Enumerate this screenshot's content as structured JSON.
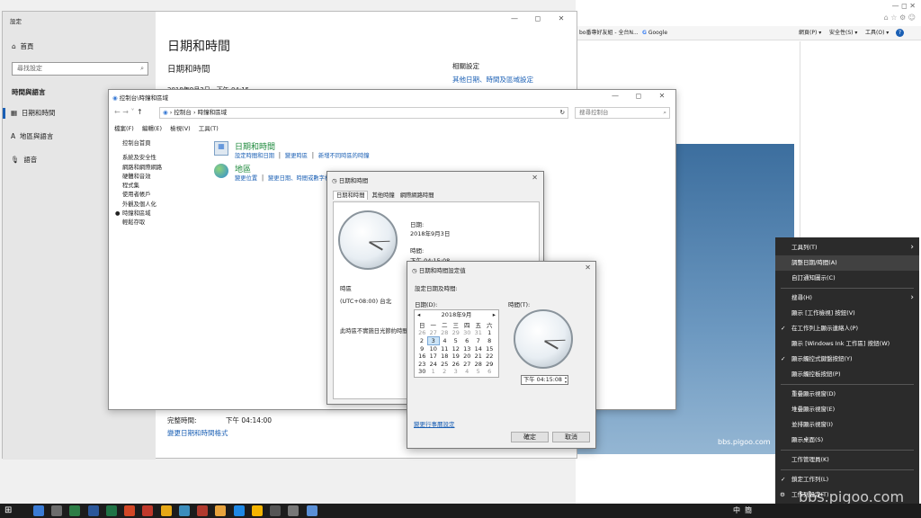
{
  "browser": {
    "tabs_text": "bo番專好友組 - 全台N...",
    "google_label": "Google",
    "toolbar": [
      "網頁(P) ▾",
      "安全性(S) ▾",
      "工具(O) ▾",
      "?"
    ],
    "page_number": "3",
    "watermark": "bbs.pigoo.com"
  },
  "settings": {
    "title": "設定",
    "home": "首頁",
    "search_placeholder": "尋找設定",
    "section": "時間與語言",
    "nav": [
      "日期和時間",
      "地區與語言",
      "語音"
    ],
    "page_title": "日期和時間",
    "subtitle": "日期和時間",
    "current_datetime": "2018年9月3日，下午 04:15",
    "related_heading": "相關設定",
    "related_link": "其他日期、時間及區域設定",
    "full_time_label": "完整時間:",
    "full_time_value": "下午 04:14:00",
    "change_format_link": "變更日期和時間格式"
  },
  "control_panel": {
    "title": "控制台\\時鐘和區域",
    "address": [
      "控制台",
      "時鐘和區域"
    ],
    "search_placeholder": "搜尋控制台",
    "menu": [
      "檔案(F)",
      "編輯(E)",
      "檢視(V)",
      "工具(T)"
    ],
    "sidebar": [
      "控制台首頁",
      "系統及安全性",
      "網路和網際網路",
      "硬體和音效",
      "程式集",
      "使用者帳戶",
      "外觀及個人化",
      "時鐘和區域",
      "輕鬆存取"
    ],
    "active_sidebar": "時鐘和區域",
    "datetime_heading": "日期和時間",
    "datetime_links": [
      "設定時間和日期",
      "變更時區",
      "新增不同時區的時鐘"
    ],
    "region_heading": "地區",
    "region_links": [
      "變更位置",
      "變更日期、時間或數字格式"
    ]
  },
  "datetime_dialog": {
    "title": "日期和時間",
    "tabs": [
      "日期和時間",
      "其他時鐘",
      "網際網路時間"
    ],
    "date_label": "日期:",
    "date_value": "2018年9月3日",
    "time_label": "時間:",
    "time_value": "下午 04:15:08",
    "tz_label": "時區",
    "tz_value": "(UTC+08:00) 台北",
    "dst_text": "此時區不實施日光節約時間"
  },
  "set_dialog": {
    "title": "日期和時間設定值",
    "instruction": "設定日期及時間:",
    "date_label": "日期(D):",
    "time_label": "時間(T):",
    "month_title": "2018年9月",
    "weekdays": [
      "日",
      "一",
      "二",
      "三",
      "四",
      "五",
      "六"
    ],
    "weeks": [
      [
        "26",
        "27",
        "28",
        "29",
        "30",
        "31",
        "1"
      ],
      [
        "2",
        "3",
        "4",
        "5",
        "6",
        "7",
        "8"
      ],
      [
        "9",
        "10",
        "11",
        "12",
        "13",
        "14",
        "15"
      ],
      [
        "16",
        "17",
        "18",
        "19",
        "20",
        "21",
        "22"
      ],
      [
        "23",
        "24",
        "25",
        "26",
        "27",
        "28",
        "29"
      ],
      [
        "30",
        "1",
        "2",
        "3",
        "4",
        "5",
        "6"
      ]
    ],
    "selected_day": "3",
    "time_value": "下午 04:15:08",
    "calendar_link": "變更行事曆設定",
    "ok": "確定",
    "cancel": "取消"
  },
  "context_menu": {
    "items": [
      {
        "label": "工具列(T)",
        "arrow": true
      },
      {
        "label": "調整日期/時間(A)",
        "highlight": true
      },
      {
        "label": "自訂通知圖示(C)"
      },
      {
        "sep": true
      },
      {
        "label": "搜尋(H)",
        "arrow": true
      },
      {
        "label": "顯示 [工作檢視] 按鈕(V)"
      },
      {
        "label": "在工作列上顯示連絡人(P)",
        "check": true
      },
      {
        "label": "顯示 [Windows Ink 工作區] 按鈕(W)"
      },
      {
        "label": "顯示觸控式鍵盤按鈕(Y)",
        "check": true
      },
      {
        "label": "顯示觸控板按鈕(P)"
      },
      {
        "sep": true
      },
      {
        "label": "重疊顯示視窗(D)"
      },
      {
        "label": "堆疊顯示視窗(E)"
      },
      {
        "label": "並排顯示視窗(I)"
      },
      {
        "label": "顯示桌面(S)"
      },
      {
        "sep": true
      },
      {
        "label": "工作管理員(K)"
      },
      {
        "sep": true
      },
      {
        "label": "鎖定工作列(L)",
        "check": true
      },
      {
        "label": "工作列設定(T)",
        "gear": true
      }
    ]
  },
  "taskbar": {
    "ime": "中",
    "ime2": "簡"
  }
}
